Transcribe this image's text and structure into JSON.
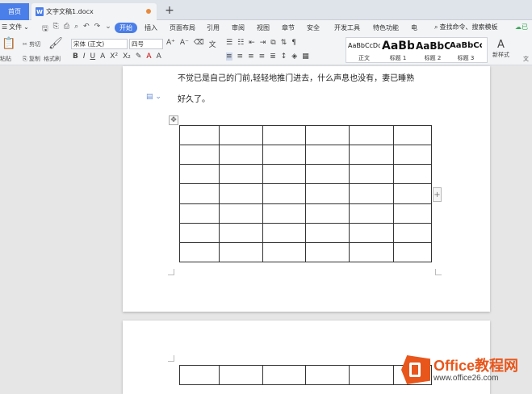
{
  "tabs": {
    "home": "首页",
    "doc_title": "文字文稿1.docx",
    "add": "+"
  },
  "menu": {
    "file": "文件",
    "tabs": [
      "开始",
      "插入",
      "页面布局",
      "引用",
      "审阅",
      "视图",
      "章节",
      "安全",
      "开发工具",
      "特色功能",
      "电"
    ],
    "active_tab": "开始",
    "search_cmd": "查找命令、搜索模板",
    "cloud": "已"
  },
  "ribbon": {
    "paste": "粘贴",
    "cut": "剪切",
    "copy": "复制",
    "format_painter": "格式刷",
    "font_name": "宋体 (正文)",
    "font_size": "四号",
    "styles": [
      {
        "sample": "AaBbCcDd",
        "name": "正文"
      },
      {
        "sample": "AaBb",
        "name": "标题 1"
      },
      {
        "sample": "AaBbC",
        "name": "标题 2"
      },
      {
        "sample": "AaBbCc",
        "name": "标题 3"
      }
    ],
    "new_style": "新样式",
    "text_tools": "文"
  },
  "document": {
    "line1": "不觉已是自己的门前,轻轻地推门进去，什么声息也没有，妻已睡熟",
    "line2": "好久了。",
    "table1": {
      "rows": 7,
      "cols": 6
    },
    "table2": {
      "rows": 1,
      "cols": 6
    }
  },
  "watermark": {
    "brand": "Office教程网",
    "url": "www.office26.com"
  },
  "colors": {
    "accent": "#4a7ee8",
    "watermark": "#e8561c"
  }
}
